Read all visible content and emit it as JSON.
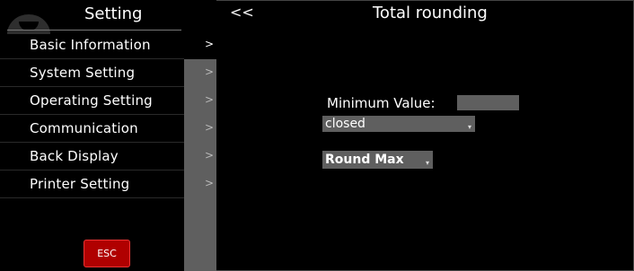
{
  "sidebar": {
    "title": "Setting",
    "items": [
      {
        "label": "Basic Information",
        "arrow": ">"
      },
      {
        "label": "System Setting",
        "arrow": ">"
      },
      {
        "label": "Operating Setting",
        "arrow": ">"
      },
      {
        "label": "Communication",
        "arrow": ">"
      },
      {
        "label": "Back Display",
        "arrow": ">"
      },
      {
        "label": "Printer Setting",
        "arrow": ">"
      }
    ],
    "esc_label": "ESC"
  },
  "header": {
    "back_label": "<<",
    "title": "Total rounding"
  },
  "form": {
    "min_label": "Minimum Value:",
    "min_value": "",
    "mode_select": "closed",
    "round_select": "Round Max",
    "caret": "▾"
  },
  "colors": {
    "background": "#000000",
    "panel_gray": "#5f5f5f",
    "esc_red": "#b00000"
  }
}
